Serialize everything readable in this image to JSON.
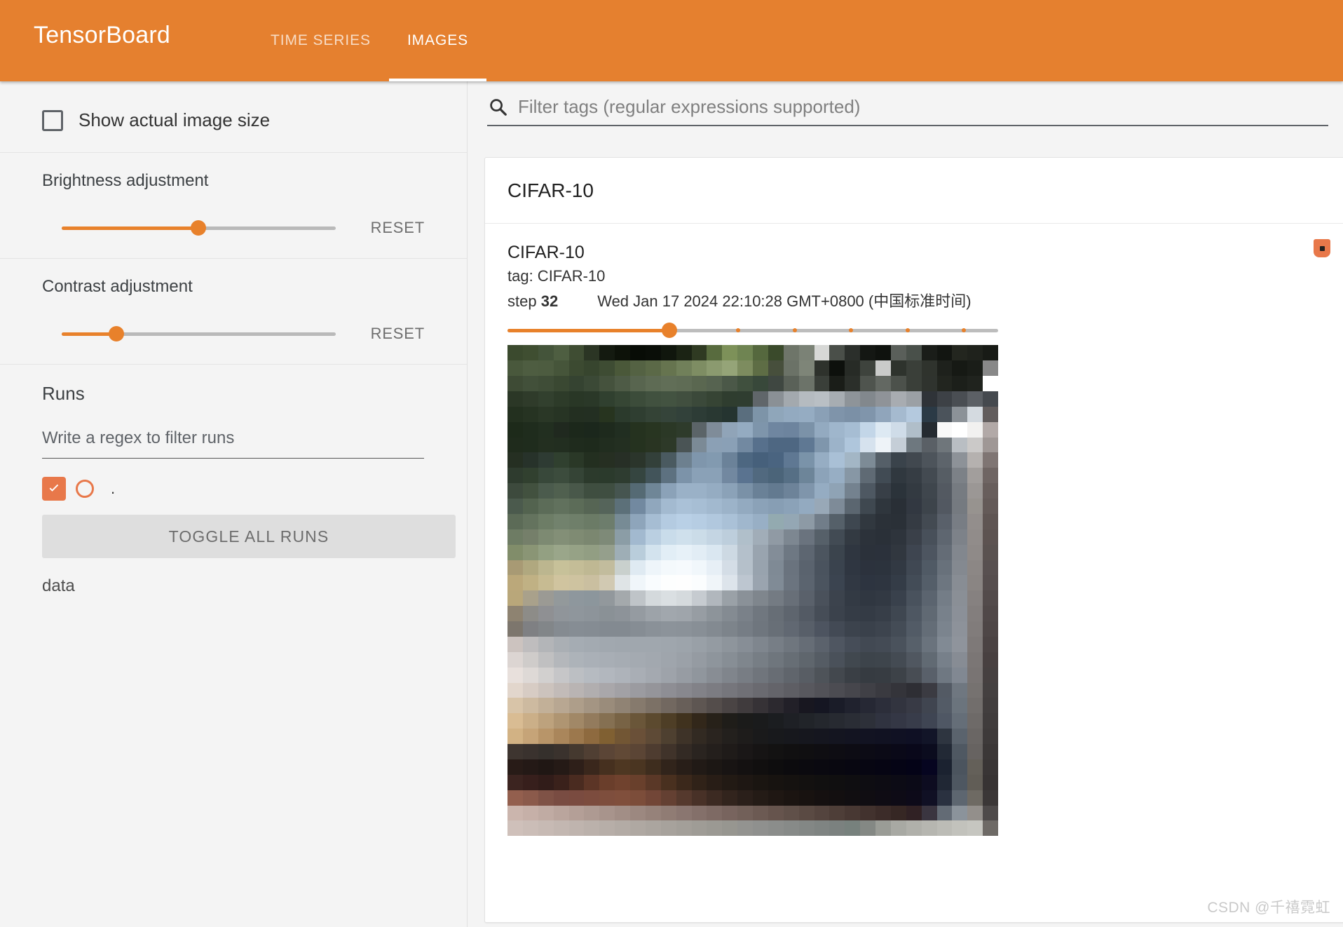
{
  "header": {
    "brand": "TensorBoard",
    "tabs": [
      {
        "label": "TIME SERIES",
        "active": false
      },
      {
        "label": "IMAGES",
        "active": true
      }
    ],
    "accent_color": "#e5802f"
  },
  "sidebar": {
    "show_actual_size": {
      "label": "Show actual image size",
      "checked": false
    },
    "brightness": {
      "label": "Brightness adjustment",
      "reset_label": "RESET",
      "value_pct": 50
    },
    "contrast": {
      "label": "Contrast adjustment",
      "reset_label": "RESET",
      "value_pct": 20
    },
    "runs": {
      "title": "Runs",
      "filter_placeholder": "Write a regex to filter runs",
      "filter_value": "",
      "items": [
        {
          "label": ".",
          "checked": true,
          "color": "#e8784a"
        }
      ],
      "toggle_all_label": "TOGGLE ALL RUNS",
      "data_label": "data"
    }
  },
  "main": {
    "filter": {
      "placeholder": "Filter tags (regular expressions supported)",
      "value": "",
      "icon": "search-icon"
    },
    "card": {
      "group_title": "CIFAR-10",
      "image": {
        "title": "CIFAR-10",
        "tag": "tag: CIFAR-10",
        "step_label": "step",
        "step_value": "32",
        "timestamp": "Wed Jan 17 2024 22:10:28 GMT+0800 (中国标准时间)",
        "step_slider_pct": 33,
        "pin_icon": "pin-icon"
      }
    }
  },
  "watermark": "CSDN @千禧霓虹",
  "image_pixels": {
    "width": 32,
    "height": 32,
    "rows": [
      "3b4a2e,3f4e31,44543a,4e5e41,3f4d33,2b3524,141a10,0d1209,080c06,0a0e08,10160d,1b2314,2f3a22,586b3e,7d9159,6f8452,55683e,3a4a2b,6e7569,7b8276,63696042,4a4f49,2b2f2b,141713,0f120e,5a5f5a,49504a,1a1d19,121511,23261f,1f221c,181b16",
      "49583c,4e5d41,4d5c40,46553a,3c4a31,37452e,3e4c33,4a5839,546243,5b6947,66744f,71805a,7e8d63,8b9a6f,95a478,7d8c5f,5e6d45,474f3c,6b7267,7e8578,2e322c,0d100c,272b26,3e433d,33383242,2e332d,3a3f39,2f332d,1e211c,161914,1a1d18",
      "3e4b35,42503a,3f4d37,3a4832,354331,3b4936,45523d,4e5b46,58654f,5e6b54,616e57,5f6c55,5a6750,566350,4b5848,40503e,38483a,3f4741,5a6158,6c7369,3a3f39,1a1d18,2b2f2a,4f544e,636862,4c514b,3a3f39,2f332e,22251f,1c1f1a,20231e,25282300",
      "2b3726,2f3b2a,32402e,2d3b29,293726,2a3828,30402f,364634,3c4c3a,41513f,435341,414f3f,3b493a,364434,2f3d2f,2f3d30,60666a,8a9095,a3a9ae,b5bbc0,b9bfc4,a7adb2,8e9499,82888d,8f9398,a8acb1,9ba0a5,2f3338,3d4146,4a4e53,5c6065,45494e",
      "23301f,263322,2a3726,273424,232f21,232f22,27341f,2b3a2c,2f3e31,344336,35443a,32413a,2d3c36,293832,253430,5a6e7e,7d94a8,8fa6ba,93aac0,95acc2,8aa0b6,7f94aa,7b90a6,8095ab,90a5bb,a5bacf,b4c9de,2b3a46,4b535b,8c9298,d4dae0,625d5d",
      "1d2a1a,1f2c1d,222f20,20291f,1c281b,1b271c,1e2a1d,212e21,25321f,283521,2b3826,2e3b2b,5b6468,7f8c99,90a4b8,94abc1,7e95ab,6f86a0,6d849e,7b92a8,93aac0,9fb6cc,a6bdd3,c3d6e8,dde9f3,cfdce8,b0bec9,252b31,f9f9f9,ffffff,f2f1f0,b2a9a7",
      "1f2b1c,1f2c1d,232f20,222e20,1f2b1d,1e2a1c,212d1f,232f21,25321f,293422,2d3928,4a5455,7b8a96,8ba0b5,8aa0b6,7289a1,57708c,4e6782,4e6782,5f7893,7f96ac,9cb3c9,afc6dc,d6e2ee,eef3f8,c5ced7,6e787f,5a6066,6f767b,b9bec3,cbc9c8,9f9795",
      "252f22,27322a,2e3b33,30402f,2a3827,232f20,262f22,272f26,2b352b,33403a,4a5a60,6d808f,7f96ac,829ab0,6b8299,4d6781,46607b,4a6480,5f7893,7a93a9,96adc3,a9c0d6,a3b6c5,7d8b96,555f68,3a434b,41484f,4d545b,5d646b,8d9298,b5b1af,7f7573",
      "2e3b2e,31402f,38483a,3c4c3d,354436,2c3a2c,2b3a2c,2e3c30,354540,42545a,5d7180,7c93a9,8aa1b7,8aa1b7,7288a0,5a7390,51697f,4b6479,566f85,6d8599,8ca3b9,97aec4,8797a5,5f6a74,414b54,30383f,363d44,434a51,565d64,7c8187,a29e9c,6f6563",
      "3d4a3d,42513f,4b5b4d,50604f,49584a,3f4e40,3f4e41,465550,556a74,6f8697,8ba2b8,9ab1c7,9ab1c7,95acc2,8ba2b8,7a91a7,6a8197,637a90,6d8399,7f95ab,95acc2,8fa3b5,74828f,4e5862,383f47,2b333a,333a41,3f464d,535961,767b81,9b9795,685e5c",
      "4b5a4d,53634f,5c6c58,61715d,5c6c58,566554,55645a,5c7079,7289a0,90a7bd,a3bad0,aac1d7,a7bed4,a2b9cf,9cb3c9,93aac0,8ba2b8,879eb4,8ba2b8,93aac0,98a8b7,7e8b98,5b6670,3f4850,2f363d,292f36,323841,3d444b,525861,757a80,97938f,645a58",
      "5c6b57,64735e,6d7d66,72826d,6f7f6a,6b7b66,6d7d6c,778b95,8ea5bb,a6bdd3,b4cbe1,b9d0e6,b6cde3,b1c8de,aac1d7,a0b7cd,98afc5,93aab0,94a7b4,8d9aa5,717d89,556069,3e4750,31383f,2b3138,2a3037,353b43,434a52,59606a,787d84,938e8c,5f5553",
      "6e7c64,757f6a,7d8a72,838f77,7f8b73,7b8770,7e8a78,8b9da6,a2b9cf,bacfe1,c9dcea,cfe0ec,cbdce8,c4d5e3,bdced c,b0bfca,a1adb8,909aa4,7d8791,6a737e,566069,424b54,333a42,2c323a,2a3038,2e343c,3a4049,48505a,5e6670,7d8289,918c8a,5d5351",
      "818d6a,8a9575,93a082,9aa68a,96a286,929e83,959f8c,9eaeb6,b9cddb,d3e3ee,e2eef6,e7f1f8,e2edf5,dae7f1,cdd9e3,b4c0cb,99a4af,838d98,6e7883,5d6671,4c555f,3b444d,2f3640,2b313a,2b313b,31373f,3e4550,4d5560,646c76,82878e,8f8a88,5a5250",
      "a89a74,b0a87f,bcb68f,c7c199,c4bd97,bfb893,c2bc9d,c9d0cd,dfeaf2,eef5fa,f4f9fc,f6fafd,f1f7fb,e7eff6,d4dde6,b5c0ca,98a3ae,7f8a95,6a737e,5a636e,4a535e,3a434e,2f3641,2c323d,2c333d,323943,404853,505a65,68717b,848990,8c8785,585050",
      "bba87a,c0b184,c7bb92,d0c49f,cec3a0,cabfa0,d1c9b2,dfe4e6,f0f6fa,f9fcfe,fdfefe,fefefe,fbfdfe,f0f5f9,dde4eb,bdc6d0,9aa4af,808b96,6b747f,5b646f,4b545f,3b4450,313843,2d3440,2e3540,343c47,434c57,545e69,6d7680,888d94,8a8583,564e4e",
      "b9a77a,a9a18b,9b9a94,93999b,8e979d,8c969c,92989c,a4a9ac,bfc4c8,d4d9dc,dadfe2,d5dadd,c6cbd0,b1b7bd,9aa1a7,8a9198,7f868d,747b83,686f78,5a616b,4a515b,3c434d,333a44,303741,323943,39414c,49525d,5b646f,747d87,8a8f96,868180,534b4b",
      "8e8371,8d8c88,8f9093,90959a,8f969c,8d949a,8a9196,8d9399,959ba1,9da3a9,a1a7ad,9fa5ab,979da3,8d949a,848b92,7a8189,70777f,676e76,5e656e,535a64,464d57,3b424c,353c46,343b45,373e48,3f4751,4e5762,606973,78818b,8b9098,837e7d,504848",
      "7d766d,7f8083,828689,858b91,868d94,858c93,838a91,838a91,868d94,8a9198,8c939a,8b9299,888f96,838a91,7d848b,767d85,6f767e,686f77,616872,585f69,4d5460,434a55,3c434d,3a414b,3d444e,444c56,525b66,646d77,7b848e,8d929a,817c7b,4e4646",
      "ccc3bf,bfbdbe,b3b5b8,aaafb4,a5acb3,a3aab1,a1a8af,a0a7ae,a0a7ae,a0a7ae,9fa6ad,9da4ab,99a0a7,949ba2,8e959c,878e96,7f868e,777e86,6f767e,666d76,5b626c,4f5661,464d58,424953,444b55,4a525c,57606a,6a737d,818a94,8f949c,7e7978,4b4343",
      "dcd5d2,cfccca,c0c0c1,b4b7bb,adb3b9,aab0b7,a8aeb5,a6acb3,a4aab1,a2a8af,9fa5ac,9ba1a8,959ba2,8e959c,878e95,7f868d,777e85,6f767d,676e75,5f666d,555c64,4a515a,41484f,3d444b,3e454c,444b53,505760,616a73,77808a,878c94,7b7675,484040",
      "e8e0dc,ded9d6,d2d0cf,c6c6c8,bcbfc3,b6bbc1,b2b7be,aeb3ba,a9aeb5,a4a9b0,9ea3aa,979ca3,9096 9d,888d94,80858c,787d84,70757c,686d74,60656c,585d64,4e5359,43484e,3a3f45,363b41,373c42,3d4248,484d54,59606a,6f78 82,818892,797473,464040",
      "e2d6cc,d7ccc4,ccc3bd,c2bbb8,b9b4b3,b1aeaf,a9a7aa,a2a1a5,9b9ba0,95959a,8e8e94,88888e,828288,7c7c82,76767c,707076,6a6a70,64646a,5e5e64,58585e,525258,4c4c52,46464c,404046,3a3a40,34343a,2e2e34,3b3b42,535a64,6f7780,767270,444040",
      "d8c4a8,cdbaa0,c2b098,b8a792,ae9e8a,a49583,9a8c7b,908374,867a6d,7c7166,726860,685f59,5e5652,544d4b,4a4444,403b3d,363236,2c292f,222028,181720,151622,1a1c28,20222e,262834,2c2e3a,32343f,383a45,404550,535b66,6b747d,726e6c,423e3e",
      "d9bc93,cbaf88,bda27d,af9572,a18867,937b5d,857052,786345,6a5639,5c4a2f,4e3e26,40321e,32271a,272119,1f1d19,1b1b1a,1a1b1c,1b1d20,1e2025,212429,24272d,272a31,2a2d35,2d3039,303340,343745,383c4a,3f4553,4f5764,656e78,6e6a68,403c3c",
      "d2b284,c6a478,b89569,aa865b,9c784d,8e6a3f,806032,725634,6a5038,5e4a36,4e4030,3e3328,322a22,2a241f,23201d,1e1c1b,1a1a1b,18191c,17181d,16171e,15161f,141520,131421,121322,111222,101123,0f1024,121528,2e3540,5a636d,6a6664,3e3a3a",
      "3e3530,3a322e,35302c,3a322d,45392f,503f33,5b4536,614936,5b4535,4e3c30,40332a,332a24,2a2420,241f1c,1f1b19,1a1717,161414,131212,111011,100f11,0f0e12,0e0d13,0d0c14,0c0b15,0b0a16,0a0918,09081a,0b0c1e,222935,4f5862,676361,3b3737",
      "281b17,241916,20171 4,251a16,2e1f19,3a271c,46301f,4e3722,4a3521,3e2d1e,31241b,281e18,211a16,1c1714,181413,141111,110f0f,0e0d0e,0c0b0e,0b0a0f,0a0910,090810,080711,070612,060513,050415,040317,060520,1b2230,4b545e,646059,393535",
      "3c2420,371f1c,31 1c19,3a211b,4a2b20,5c3526,6a3e2b,70422e,69402c,5a3827,49301f,3b281b,302218,281d16,221a14,1e1713,1a1511,171310,151210,131110,111010,100f10,0f0e11,0e0d12,0d0c13,0c0b15,0b0a17,0d0c20,202734,4e5761,615d56,373333",
      "935f4e,8b5a4b,7f5246,794c42,7a4b40,7c4c3e,7e4e3d,804f3c,7c4d3a,724637,644032,55392d,483127,3c2a22,32241d,2a1f1a,241b16,1f1713,1b1411,181210,151010,130f10,110e11,100d12,0f0c14,0e0b16,0d0a19,101024,2a3140,5d6670,6e6a63,3b3737",
      "cbb5ad,c6b0a8,c0aba3,baa59d,b49f97,ae9a92,a8948c,a28e86,9c8880,96827a,907c74,8a7670,84706a,7e6a64,78645e,726059,6c5a53,66544d,605049,5a4a43,54443e,4e3e38,483833,42322e,3c2c29,362724,302124,3a3540,636b75,8b939b,938f8b,4e4a4a",
      "cfc0ba,cbbdb7,c7bab4,c3b7b1,bfb4ae,bbb1ab,b7aea8,b3aba5,afa8a2,aba59f,a7a29c,a39f99,9f9c96,9b9993,979690,939390,8f908e,8b8d8b,878a88,838785,7f8482,7b817f,77817d,848884,9a9c96,a8a9a3,b0b0aa,b6b6b0,bcbcb6,c2c2bc,c6c6c0,6e6a66"
    ]
  }
}
